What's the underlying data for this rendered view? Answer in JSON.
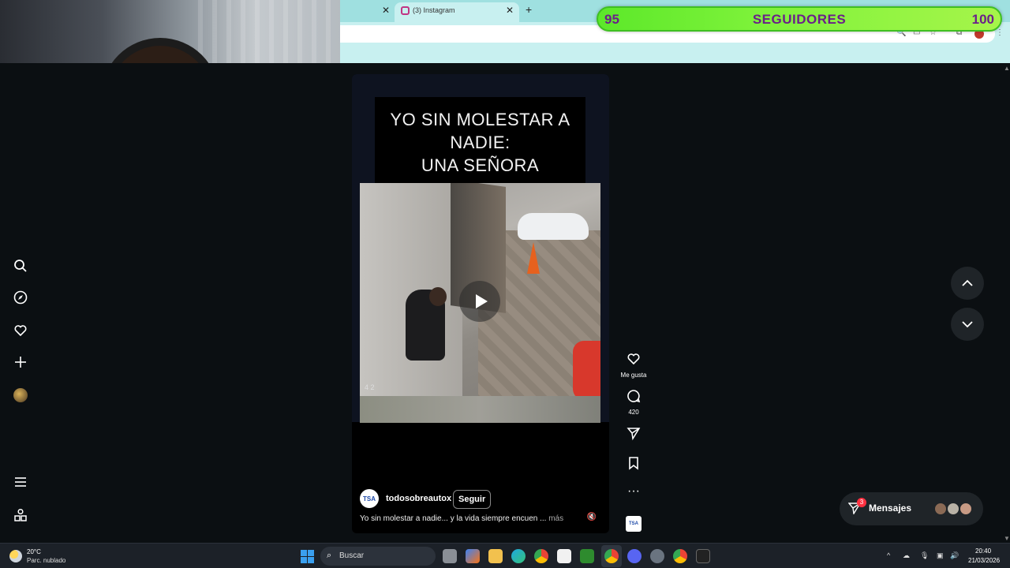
{
  "browser": {
    "tab_title": "(3) Instagram",
    "close_glyph": "✕",
    "new_tab_glyph": "+"
  },
  "followers_overlay": {
    "current": "95",
    "label": "SEGUIDORES",
    "goal": "100",
    "current_value": 95,
    "goal_value": 100,
    "color": "#7ef23a"
  },
  "reel": {
    "overlay_text": "YO SIN MOLESTAR A\nNADIE:\nUNA SEÑORA",
    "video_time": "4 2",
    "account_avatar_text": "TSA",
    "account_name": "todosobreautox",
    "follow_label": "Seguir",
    "description": "Yo sin molestar a nadie... y la vida siempre encuen ...",
    "more_label": "más",
    "mute_icon": "speaker-muted-icon"
  },
  "actions": {
    "like_label": "Me gusta",
    "comments_count": "420",
    "thumb_text": "TSA"
  },
  "messages": {
    "label": "Mensajes",
    "badge": "3"
  },
  "taskbar": {
    "temperature": "20°C",
    "weather": "Parc. nublado",
    "search_placeholder": "Buscar",
    "time": "20:40",
    "date": "21/03/2026"
  },
  "colors": {
    "accent_followers": "#7ef23a",
    "followers_text": "#6b1f8a",
    "browser_tab": "#9fe0e0",
    "notification": "#ff3040"
  }
}
